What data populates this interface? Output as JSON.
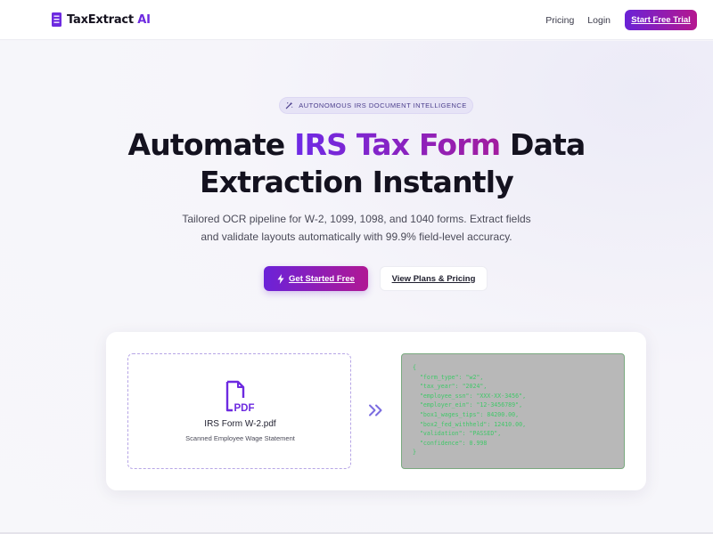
{
  "nav": {
    "logo_text": "TaxExtract",
    "logo_accent": "AI",
    "logo_icon": "document-icon",
    "links": [
      {
        "label": "Pricing"
      },
      {
        "label": "Login"
      }
    ],
    "cta_label": "Start Free Trial"
  },
  "hero": {
    "badge_icon": "magic-wand-icon",
    "badge_text": "AUTONOMOUS IRS DOCUMENT INTELLIGENCE",
    "headline_line1_pre": "Automate ",
    "headline_line1_highlight": "IRS Tax Form",
    "headline_line1_post": " Data",
    "headline_line2": "Extraction Instantly",
    "subtitle_line1": "Tailored OCR pipeline for W-2, 1099, 1098, and 1040 forms. Extract fields",
    "subtitle_line2": "and validate layouts automatically with 99.9% field-level accuracy.",
    "primary_cta": {
      "icon": "lightning-bolt-icon",
      "label": "Get Started Free"
    },
    "secondary_cta": {
      "label": "View Plans & Pricing"
    }
  },
  "demo": {
    "file_icon": "pdf-file-icon",
    "file_icon_text": "PDF",
    "file_name": "IRS Form W-2.pdf",
    "file_description": "Scanned Employee Wage Statement",
    "arrow_icon": "double-chevron-right-icon",
    "json_output": [
      "{",
      "  \"form_type\": \"w2\",",
      "  \"tax_year\": \"2024\",",
      "  \"employee_ssn\": \"XXX-XX-3456\",",
      "  \"employer_ein\": \"12-3456789\",",
      "  \"box1_wages_tips\": 84200.00,",
      "  \"box2_fed_withheld\": 12410.00,",
      "  \"validation\": \"PASSED\",",
      "  \"confidence\": 0.998",
      "}"
    ]
  },
  "colors": {
    "brand_primary": "#6d2ae0",
    "brand_secondary": "#b5178f",
    "json_text": "#42c76a",
    "json_panel_bg": "#b8b8b8"
  }
}
